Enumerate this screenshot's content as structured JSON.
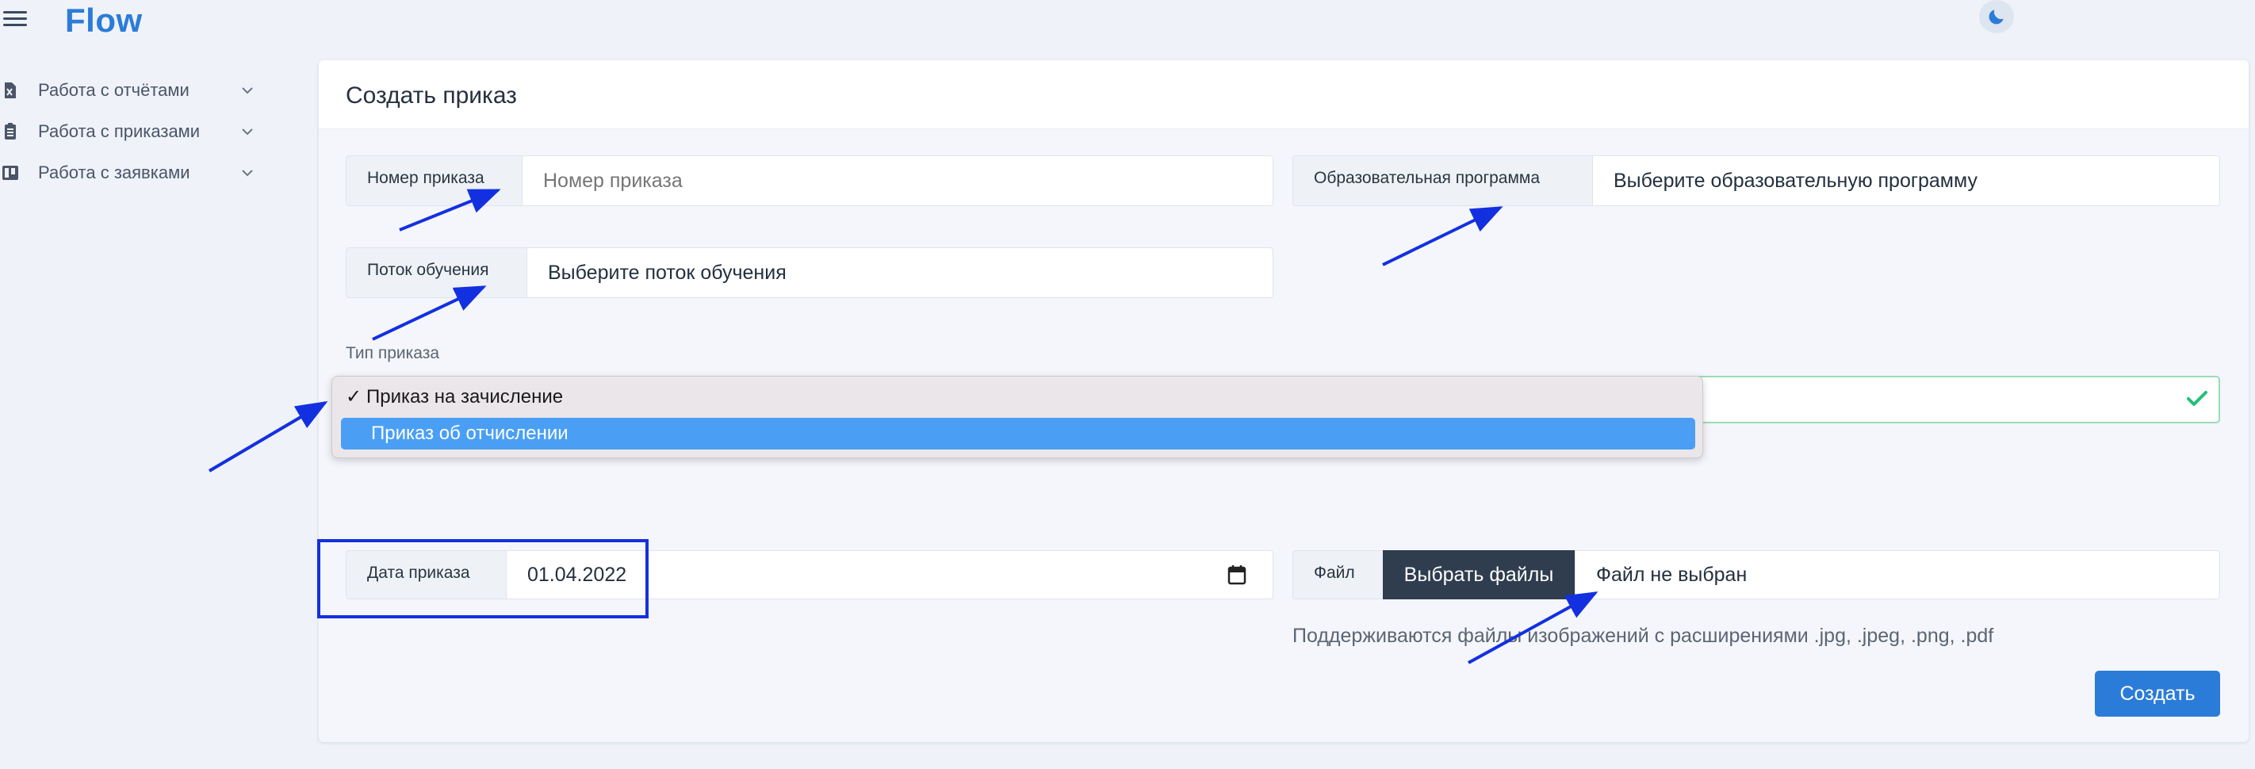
{
  "app": {
    "logo": "Flow",
    "theme_toggle_icon": "moon-icon",
    "menu_icon": "hamburger-icon"
  },
  "sidebar": {
    "items": [
      {
        "label": "Работа с отчётами",
        "icon": "excel-file-icon"
      },
      {
        "label": "Работа с приказами",
        "icon": "document-list-icon"
      },
      {
        "label": "Работа с заявками",
        "icon": "kanban-board-icon"
      }
    ]
  },
  "page": {
    "title": "Создать приказ"
  },
  "form": {
    "order_number": {
      "label": "Номер приказа",
      "placeholder": "Номер приказа",
      "value": ""
    },
    "program": {
      "label": "Образовательная программа",
      "value": "Выберите образовательную программу"
    },
    "stream": {
      "label": "Поток обучения",
      "value": "Выберите поток обучения"
    },
    "order_type": {
      "label": "Тип приказа",
      "options": [
        {
          "label": "Приказ на зачисление",
          "checked": true
        },
        {
          "label": "Приказ об отчислении",
          "highlighted": true
        }
      ]
    },
    "order_date": {
      "label": "Дата приказа",
      "value": "01.04.2022",
      "icon": "calendar-icon"
    },
    "file": {
      "label": "Файл",
      "button": "Выбрать файлы",
      "status": "Файл не выбран",
      "hint": "Поддерживаются файлы изображений с расширениями .jpg, .jpeg, .png, .pdf"
    },
    "submit": "Создать"
  },
  "colors": {
    "accent": "#2b7cd8",
    "annotation": "#1330e0",
    "success": "#22c07a",
    "selected_option": "#4a9ff5",
    "file_button": "#2f3d4f"
  }
}
